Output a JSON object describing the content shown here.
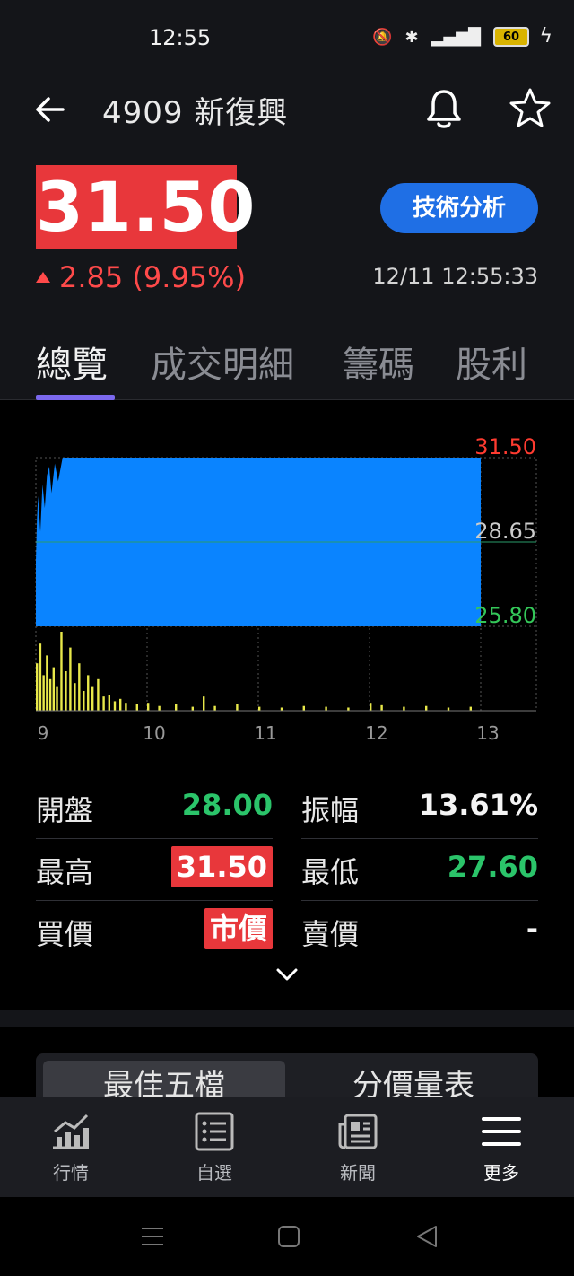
{
  "status_bar": {
    "time": "12:55",
    "battery": "60",
    "network": "4G"
  },
  "header": {
    "title": "4909 新復興"
  },
  "quote": {
    "price": "31.50",
    "change": "2.85 (9.95%)",
    "timestamp": "12/11 12:55:33",
    "technical_analysis_label": "技術分析"
  },
  "tabs": [
    {
      "label": "總覽"
    },
    {
      "label": "成交明細"
    },
    {
      "label": "籌碼"
    },
    {
      "label": "股利"
    }
  ],
  "chart_data": {
    "type": "area",
    "y_labels": [
      "31.50",
      "28.65",
      "25.80"
    ],
    "x_labels": [
      "9",
      "10",
      "11",
      "12",
      "13"
    ],
    "ylim": [
      25.8,
      31.5
    ],
    "reference_price": 28.65,
    "colors": {
      "area": "#0a84ff",
      "up_label": "#ff3b30",
      "down_label": "#34c759",
      "ref_label": "#cccccc",
      "volume": "#e8e84a"
    },
    "price_series": [
      {
        "t": 9.0,
        "p": 28.0
      },
      {
        "t": 9.01,
        "p": 29.4
      },
      {
        "t": 9.02,
        "p": 30.2
      },
      {
        "t": 9.04,
        "p": 29.0
      },
      {
        "t": 9.06,
        "p": 30.6
      },
      {
        "t": 9.08,
        "p": 29.8
      },
      {
        "t": 9.1,
        "p": 30.9
      },
      {
        "t": 9.12,
        "p": 31.2
      },
      {
        "t": 9.14,
        "p": 30.3
      },
      {
        "t": 9.17,
        "p": 31.3
      },
      {
        "t": 9.2,
        "p": 30.7
      },
      {
        "t": 9.24,
        "p": 31.5
      },
      {
        "t": 9.3,
        "p": 31.5
      },
      {
        "t": 13.0,
        "p": 31.5
      }
    ],
    "volume_series": [
      {
        "t": 9.0,
        "v": 60
      },
      {
        "t": 9.03,
        "v": 85
      },
      {
        "t": 9.06,
        "v": 45
      },
      {
        "t": 9.09,
        "v": 70
      },
      {
        "t": 9.12,
        "v": 40
      },
      {
        "t": 9.15,
        "v": 55
      },
      {
        "t": 9.18,
        "v": 30
      },
      {
        "t": 9.22,
        "v": 100
      },
      {
        "t": 9.26,
        "v": 50
      },
      {
        "t": 9.3,
        "v": 80
      },
      {
        "t": 9.34,
        "v": 35
      },
      {
        "t": 9.38,
        "v": 60
      },
      {
        "t": 9.42,
        "v": 25
      },
      {
        "t": 9.46,
        "v": 45
      },
      {
        "t": 9.5,
        "v": 30
      },
      {
        "t": 9.55,
        "v": 40
      },
      {
        "t": 9.6,
        "v": 18
      },
      {
        "t": 9.65,
        "v": 20
      },
      {
        "t": 9.7,
        "v": 12
      },
      {
        "t": 9.75,
        "v": 15
      },
      {
        "t": 9.8,
        "v": 10
      },
      {
        "t": 9.9,
        "v": 8
      },
      {
        "t": 10.0,
        "v": 10
      },
      {
        "t": 10.1,
        "v": 6
      },
      {
        "t": 10.25,
        "v": 8
      },
      {
        "t": 10.4,
        "v": 5
      },
      {
        "t": 10.5,
        "v": 18
      },
      {
        "t": 10.6,
        "v": 6
      },
      {
        "t": 10.8,
        "v": 8
      },
      {
        "t": 11.0,
        "v": 5
      },
      {
        "t": 11.2,
        "v": 4
      },
      {
        "t": 11.4,
        "v": 6
      },
      {
        "t": 11.6,
        "v": 5
      },
      {
        "t": 11.8,
        "v": 4
      },
      {
        "t": 12.0,
        "v": 10
      },
      {
        "t": 12.1,
        "v": 7
      },
      {
        "t": 12.3,
        "v": 5
      },
      {
        "t": 12.5,
        "v": 6
      },
      {
        "t": 12.7,
        "v": 4
      },
      {
        "t": 12.9,
        "v": 5
      }
    ]
  },
  "stats": {
    "open_label": "開盤",
    "open_value": "28.00",
    "amplitude_label": "振幅",
    "amplitude_value": "13.61%",
    "high_label": "最高",
    "high_value": "31.50",
    "low_label": "最低",
    "low_value": "27.60",
    "bid_label": "買價",
    "bid_value": "市價",
    "ask_label": "賣價",
    "ask_value": "-"
  },
  "segments": {
    "best_five": "最佳五檔",
    "price_volume": "分價量表"
  },
  "bottom_nav": [
    {
      "label": "行情",
      "icon": "market-chart-icon"
    },
    {
      "label": "自選",
      "icon": "watchlist-icon"
    },
    {
      "label": "新聞",
      "icon": "news-icon"
    },
    {
      "label": "更多",
      "icon": "menu-icon"
    }
  ]
}
